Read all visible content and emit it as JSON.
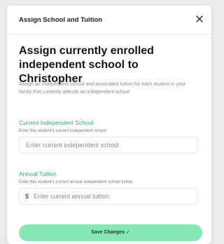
{
  "modal": {
    "header_title": "Assign School and Tuition",
    "close_glyph": "×",
    "title": "Assign currently enrolled independent school to Christopher",
    "description": "Assign an independent school and associated tuition for each student in your family that currently attends an independent school"
  },
  "school_field": {
    "label": "Current Independent School",
    "help": "Enter this student's current independent school",
    "placeholder": "Enter current independent school",
    "value": ""
  },
  "tuition_field": {
    "label": "Annual Tuition",
    "help": "Enter this student's current annual independent school tuition",
    "currency": "$",
    "placeholder": "Enter current annual tuition",
    "value": ""
  },
  "actions": {
    "save_label": "Save Changes ✓"
  },
  "colors": {
    "accent_green": "#3aa866",
    "button_bg": "#86e6b4"
  },
  "icons": {
    "close": "close-icon"
  }
}
